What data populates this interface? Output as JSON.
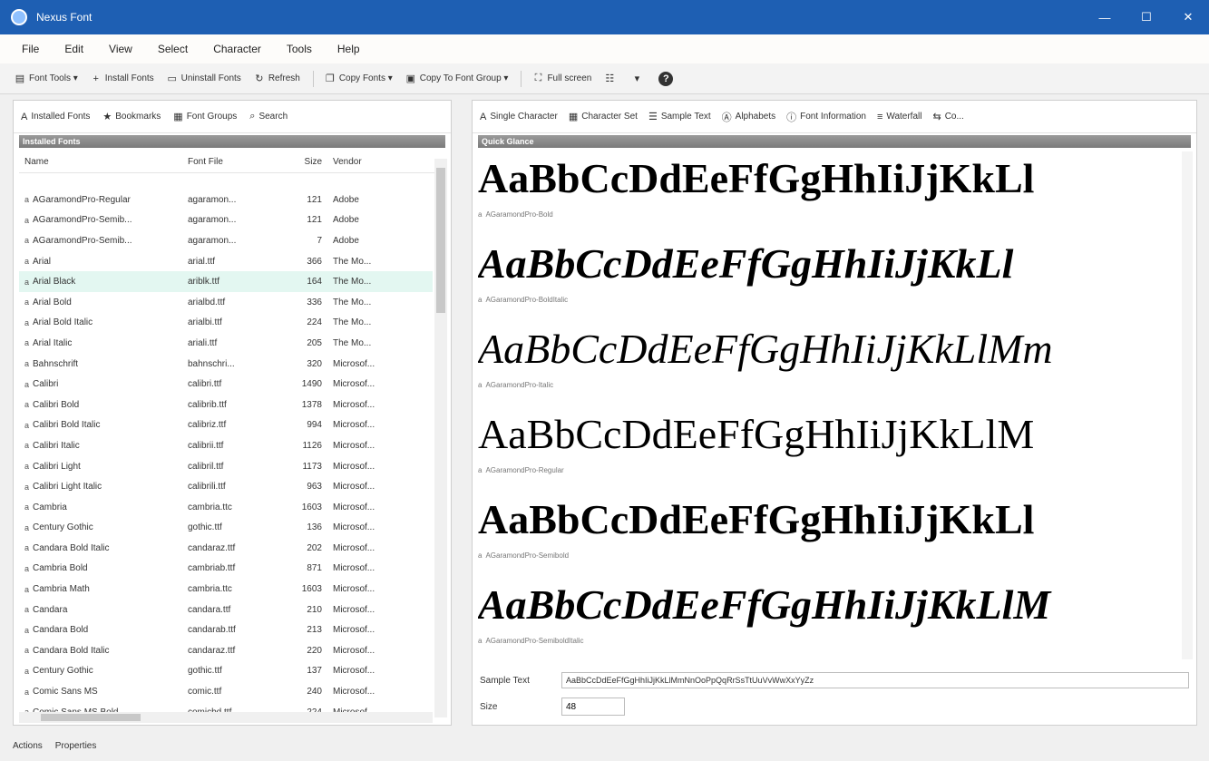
{
  "window": {
    "title": "Nexus Font",
    "controls": {
      "minimize": "—",
      "maximize": "☐",
      "close": "✕"
    }
  },
  "menu": [
    "File",
    "Edit",
    "View",
    "Select",
    "Character",
    "Tools",
    "Help"
  ],
  "toolbar": {
    "buttons": [
      {
        "name": "font-tools-button",
        "label": "Font Tools ▾",
        "icon": "font-tools-icon",
        "glyph": "▤"
      },
      {
        "name": "install-fonts-button",
        "label": "Install Fonts",
        "icon": "install-icon",
        "glyph": "+"
      },
      {
        "name": "uninstall-fonts-button",
        "label": "Uninstall Fonts",
        "icon": "uninstall-icon",
        "glyph": "▭"
      },
      {
        "name": "refresh-button",
        "label": "Refresh",
        "icon": "refresh-icon",
        "glyph": "↻"
      },
      {
        "name": "copy-fonts-button",
        "label": "Copy Fonts ▾",
        "icon": "copy-icon",
        "glyph": "❐"
      },
      {
        "name": "copy-to-font-group-button",
        "label": "Copy To Font Group ▾",
        "icon": "folder-icon",
        "glyph": "▣"
      },
      {
        "name": "full-screen-button",
        "label": "Full screen",
        "icon": "fullscreen-icon",
        "glyph": "⛶"
      }
    ],
    "view_icons": [
      {
        "name": "view-list-icon",
        "glyph": "☷"
      },
      {
        "name": "view-toggle-icon",
        "glyph": "▾"
      }
    ],
    "help": "?"
  },
  "left_pane": {
    "tabs": [
      {
        "name": "tab-installed-fonts",
        "label": "Installed Fonts",
        "icon": "installed-fonts-icon",
        "glyph": "A"
      },
      {
        "name": "tab-bookmarks",
        "label": "Bookmarks",
        "icon": "bookmark-icon",
        "glyph": "★"
      },
      {
        "name": "tab-font-groups",
        "label": "Font Groups",
        "icon": "group-icon",
        "glyph": "▦"
      },
      {
        "name": "tab-search",
        "label": "Search",
        "icon": "search-icon",
        "glyph": "⌕"
      }
    ],
    "group_header": "Installed Fonts",
    "columns": [
      "Name",
      "Font File",
      "Size",
      "Vendor"
    ],
    "rows": [
      {
        "name": "AGaramondPro-Regular",
        "file": "agaramon...",
        "size": "121",
        "vendor": "Adobe"
      },
      {
        "name": "AGaramondPro-Semib...",
        "file": "agaramon...",
        "size": "121",
        "vendor": "Adobe"
      },
      {
        "name": "AGaramondPro-Semib...",
        "file": "agaramon...",
        "size": "7",
        "vendor": "Adobe"
      },
      {
        "name": "Arial",
        "file": "arial.ttf",
        "size": "366",
        "vendor": "The Mo..."
      },
      {
        "name": "Arial Black",
        "file": "ariblk.ttf",
        "size": "164",
        "vendor": "The Mo..."
      },
      {
        "name": "Arial Bold",
        "file": "arialbd.ttf",
        "size": "336",
        "vendor": "The Mo..."
      },
      {
        "name": "Arial Bold Italic",
        "file": "arialbi.ttf",
        "size": "224",
        "vendor": "The Mo..."
      },
      {
        "name": "Arial Italic",
        "file": "ariali.ttf",
        "size": "205",
        "vendor": "The Mo..."
      },
      {
        "name": "Bahnschrift",
        "file": "bahnschri...",
        "size": "320",
        "vendor": "Microsof..."
      },
      {
        "name": "Calibri",
        "file": "calibri.ttf",
        "size": "1490",
        "vendor": "Microsof..."
      },
      {
        "name": "Calibri Bold",
        "file": "calibrib.ttf",
        "size": "1378",
        "vendor": "Microsof..."
      },
      {
        "name": "Calibri Bold Italic",
        "file": "calibriz.ttf",
        "size": "994",
        "vendor": "Microsof..."
      },
      {
        "name": "Calibri Italic",
        "file": "calibrii.ttf",
        "size": "1126",
        "vendor": "Microsof..."
      },
      {
        "name": "Calibri Light",
        "file": "calibril.ttf",
        "size": "1173",
        "vendor": "Microsof..."
      },
      {
        "name": "Calibri Light Italic",
        "file": "calibrili.ttf",
        "size": "963",
        "vendor": "Microsof..."
      },
      {
        "name": "Cambria",
        "file": "cambria.ttc",
        "size": "1603",
        "vendor": "Microsof..."
      },
      {
        "name": "Century Gothic",
        "file": "gothic.ttf",
        "size": "136",
        "vendor": "Microsof..."
      },
      {
        "name": "Candara Bold Italic",
        "file": "candaraz.ttf",
        "size": "202",
        "vendor": "Microsof..."
      },
      {
        "name": "Cambria Bold",
        "file": "cambriab.ttf",
        "size": "871",
        "vendor": "Microsof..."
      },
      {
        "name": "Cambria Math",
        "file": "cambria.ttc",
        "size": "1603",
        "vendor": "Microsof..."
      },
      {
        "name": "Candara",
        "file": "candara.ttf",
        "size": "210",
        "vendor": "Microsof..."
      },
      {
        "name": "Candara Bold",
        "file": "candarab.ttf",
        "size": "213",
        "vendor": "Microsof..."
      },
      {
        "name": "Candara Bold Italic",
        "file": "candaraz.ttf",
        "size": "220",
        "vendor": "Microsof..."
      },
      {
        "name": "Century Gothic",
        "file": "gothic.ttf",
        "size": "137",
        "vendor": "Microsof..."
      },
      {
        "name": "Comic Sans MS",
        "file": "comic.ttf",
        "size": "240",
        "vendor": "Microsof..."
      },
      {
        "name": "Comic Sans MS Bold",
        "file": "comicbd.ttf",
        "size": "224",
        "vendor": "Microsof..."
      }
    ],
    "selected_row": 4,
    "status_tabs": [
      "Actions",
      "Properties"
    ]
  },
  "right_pane": {
    "tabs": [
      {
        "name": "tab-single-character",
        "label": "Single Character",
        "icon": "character-icon",
        "glyph": "A"
      },
      {
        "name": "tab-character-set",
        "label": "Character Set",
        "icon": "grid-icon",
        "glyph": "▦"
      },
      {
        "name": "tab-sample-text",
        "label": "Sample Text",
        "icon": "text-icon",
        "glyph": "☰"
      },
      {
        "name": "tab-alphabets",
        "label": "Alphabets",
        "icon": "alphabet-icon",
        "glyph": "Ⓐ"
      },
      {
        "name": "tab-font-information",
        "label": "Font Information",
        "icon": "info-icon",
        "glyph": "ⓘ"
      },
      {
        "name": "tab-waterfall",
        "label": "Waterfall",
        "icon": "waterfall-icon",
        "glyph": "≡"
      },
      {
        "name": "tab-compare",
        "label": "Co...",
        "icon": "compare-icon",
        "glyph": "⇆"
      }
    ],
    "group_header": "Quick Glance",
    "samples": [
      {
        "text": "AaBbCcDdEeFfGgHhIiJjKkLl",
        "caption": "AGaramondPro-Bold",
        "style": "bold"
      },
      {
        "text": "AaBbCcDdEeFfGgHhIiJjKkLl",
        "caption": "AGaramondPro-BoldItalic",
        "style": "bold italic"
      },
      {
        "text": "AaBbCcDdEeFfGgHhIiJjKkLlMm",
        "caption": "AGaramondPro-Italic",
        "style": "italic"
      },
      {
        "text": "AaBbCcDdEeFfGgHhIiJjKkLlM",
        "caption": "AGaramondPro-Regular",
        "style": "regular"
      },
      {
        "text": "AaBbCcDdEeFfGgHhIiJjKkLl",
        "caption": "AGaramondPro-Semibold",
        "style": "bold"
      },
      {
        "text": "AaBbCcDdEeFfGgHhIiJjKkLlM",
        "caption": "AGaramondPro-SemiboldItalic",
        "style": "bold italic"
      }
    ],
    "sample_text": {
      "label": "Sample Text",
      "value": "AaBbCcDdEeFfGgHhIiJjKkLlMmNnOoPpQqRrSsTtUuVvWwXxYyZz"
    },
    "size": {
      "label": "Size",
      "value": "48"
    }
  }
}
